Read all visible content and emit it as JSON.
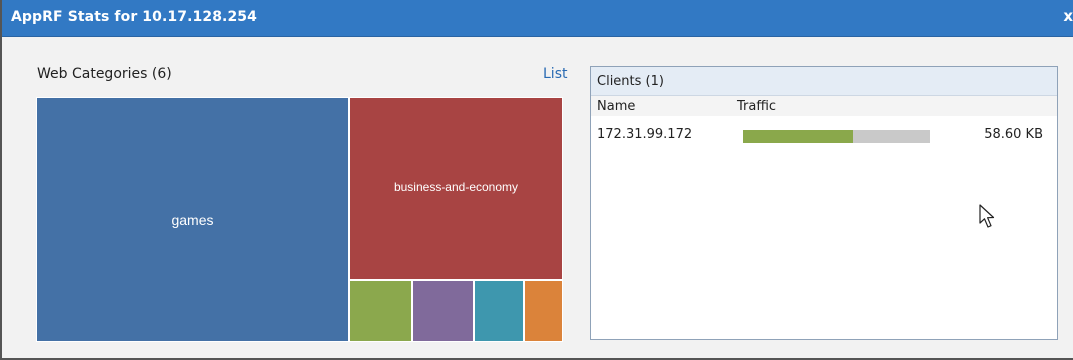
{
  "window": {
    "title": "AppRF Stats for 10.17.128.254",
    "close_label": "x",
    "colors": {
      "titlebar": "#3279c4",
      "link": "#2a6bb3"
    }
  },
  "categories_panel": {
    "title": "Web Categories (6)",
    "list_link": "List",
    "tiles": [
      {
        "label": "games",
        "color": "#4471a6"
      },
      {
        "label": "business-and-economy",
        "color": "#a84443"
      },
      {
        "label": "",
        "color": "#8ba84d"
      },
      {
        "label": "",
        "color": "#806a9b"
      },
      {
        "label": "",
        "color": "#3e97ae"
      },
      {
        "label": "",
        "color": "#db833a"
      }
    ]
  },
  "clients_panel": {
    "title": "Clients (1)",
    "columns": [
      "Name",
      "Traffic"
    ],
    "rows": [
      {
        "name": "172.31.99.172",
        "traffic": "58.60 KB",
        "traffic_fraction": 0.59
      }
    ],
    "bar_colors": {
      "fill": "#8aa84b",
      "track": "#c9c9c9"
    }
  },
  "cursor": {
    "icon": "mouse-pointer-icon"
  }
}
